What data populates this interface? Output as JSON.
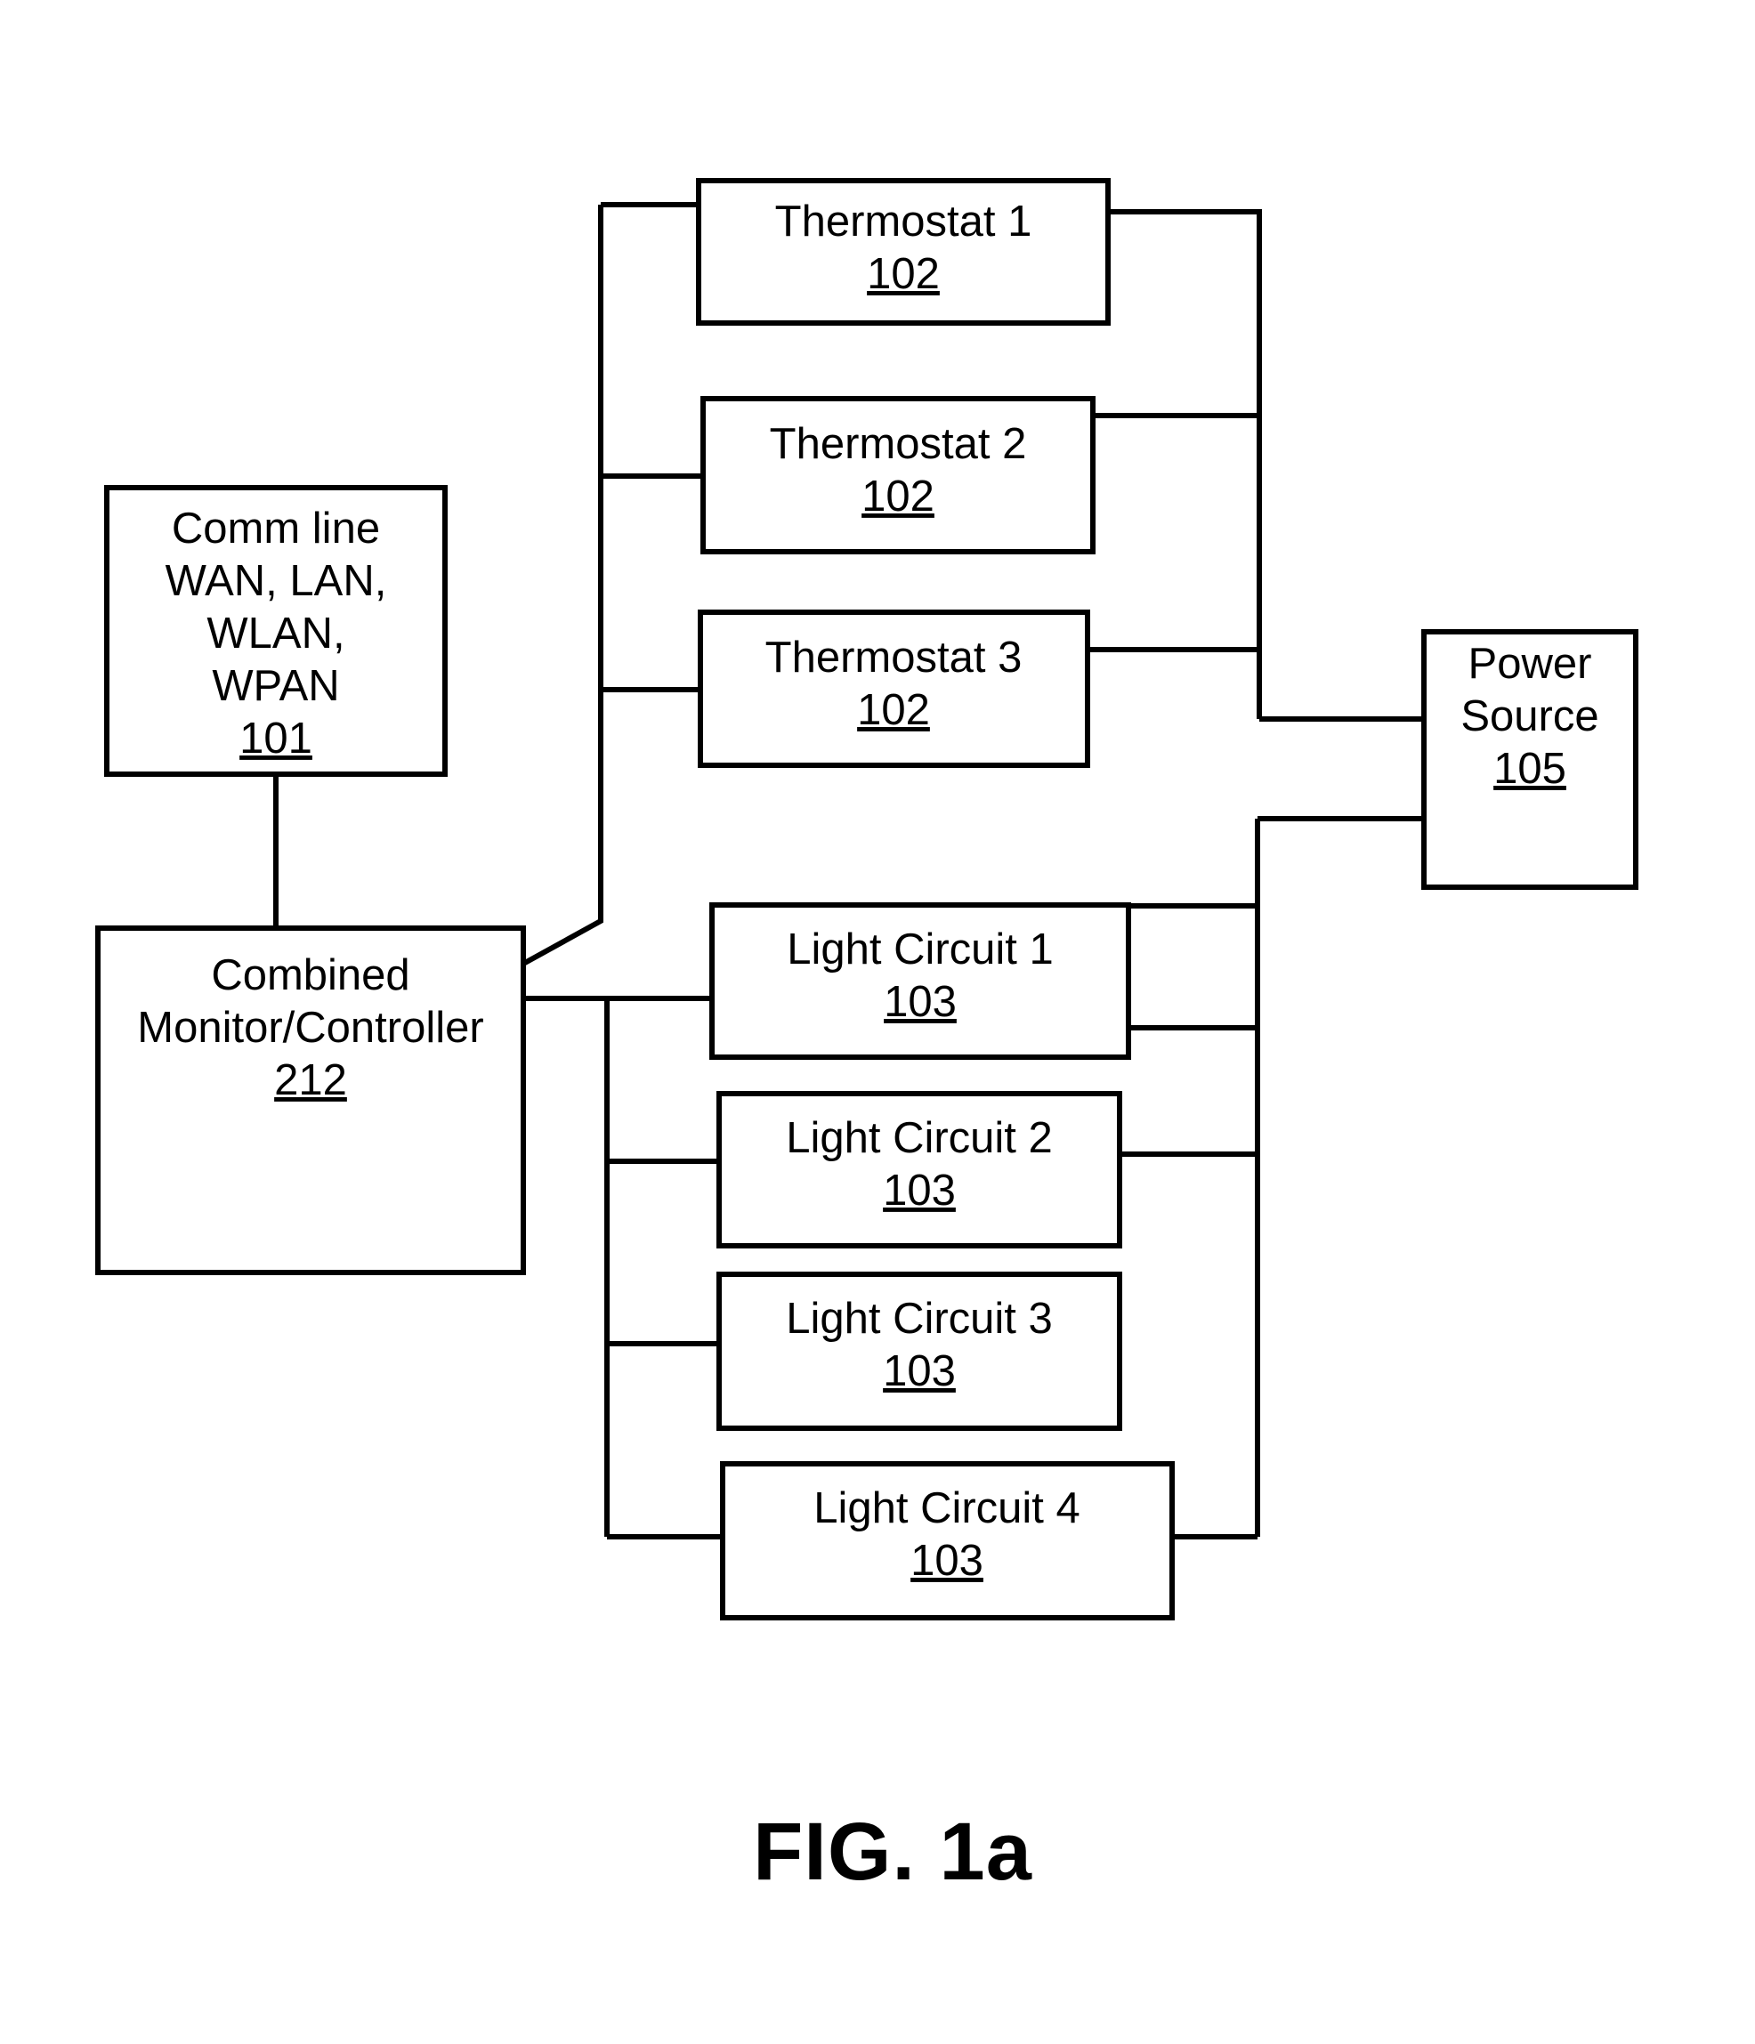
{
  "figure": {
    "caption": "FIG. 1a",
    "background_color": "#ffffff",
    "line_color": "#000000"
  },
  "blocks": {
    "comm_line": {
      "lines": [
        "Comm line",
        "WAN, LAN,",
        "WLAN,",
        "WPAN"
      ],
      "line1": "Comm line",
      "line2": "WAN, LAN,",
      "line3": "WLAN,",
      "line4": "WPAN",
      "ref": "101"
    },
    "controller": {
      "line1": "Combined",
      "line2": "Monitor/Controller",
      "ref": "212"
    },
    "power_source": {
      "line1": "Power",
      "line2": "Source",
      "ref": "105"
    },
    "thermostats": [
      {
        "label": "Thermostat 1",
        "ref": "102"
      },
      {
        "label": "Thermostat 2",
        "ref": "102"
      },
      {
        "label": "Thermostat 3",
        "ref": "102"
      }
    ],
    "light_circuits": [
      {
        "label": "Light Circuit 1",
        "ref": "103"
      },
      {
        "label": "Light Circuit 2",
        "ref": "103"
      },
      {
        "label": "Light Circuit 3",
        "ref": "103"
      },
      {
        "label": "Light Circuit 4",
        "ref": "103"
      }
    ]
  }
}
